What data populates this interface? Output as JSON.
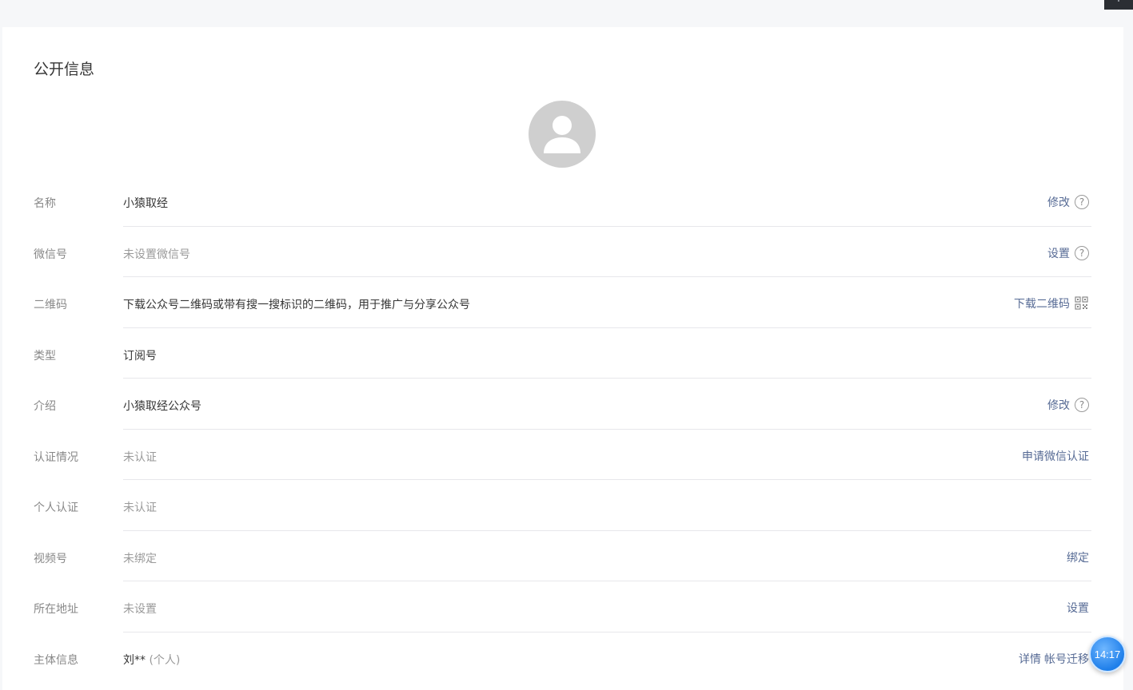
{
  "section_title": "公开信息",
  "rows": [
    {
      "label": "名称",
      "value": "小猿取经",
      "actions": [
        {
          "text": "修改"
        }
      ],
      "help": "?"
    },
    {
      "label": "微信号",
      "value": "未设置微信号",
      "actions": [
        {
          "text": "设置"
        }
      ],
      "help": "?"
    },
    {
      "label": "二维码",
      "value": "下载公众号二维码或带有搜一搜标识的二维码，用于推广与分享公众号",
      "actions": [
        {
          "text": "下载二维码"
        }
      ]
    },
    {
      "label": "类型",
      "value": "订阅号"
    },
    {
      "label": "介绍",
      "value": "小猿取经公众号",
      "actions": [
        {
          "text": "修改"
        }
      ],
      "help": "?"
    },
    {
      "label": "认证情况",
      "value": "未认证",
      "actions": [
        {
          "text": "申请微信认证"
        }
      ]
    },
    {
      "label": "个人认证",
      "value": "未认证"
    },
    {
      "label": "视频号",
      "value": "未绑定",
      "actions": [
        {
          "text": "绑定"
        }
      ]
    },
    {
      "label": "所在地址",
      "value": "未设置",
      "actions": [
        {
          "text": "设置"
        }
      ]
    },
    {
      "label": "主体信息",
      "value": "刘**",
      "value_sub": "(个人)",
      "actions": [
        {
          "text": "详情"
        },
        {
          "text": "帐号迁移"
        }
      ]
    }
  ],
  "clock_widget": {
    "time": "14:17"
  },
  "colors": {
    "link": "#576b95",
    "label": "#888888",
    "separator": "#e7e7eb",
    "avatar_bg": "#cfcfcf"
  },
  "icons": {
    "avatar": "default-user-avatar",
    "help": "question-circle-icon",
    "qr": "qr-code-icon"
  }
}
